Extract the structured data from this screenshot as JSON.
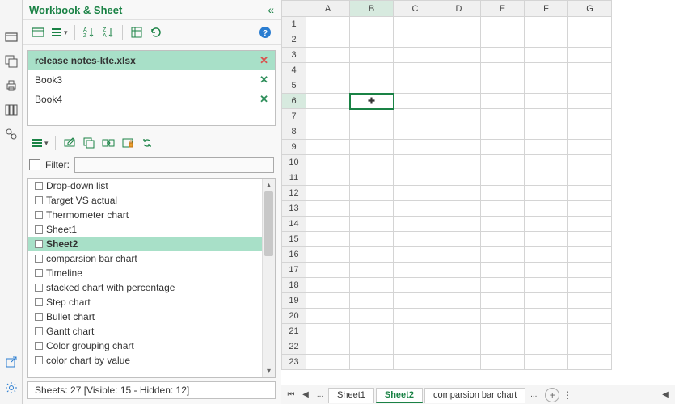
{
  "panel": {
    "title": "Workbook & Sheet",
    "filter_label": "Filter:",
    "filter_value": "",
    "status": "Sheets: 27  [Visible: 15 - Hidden: 12]"
  },
  "workbooks": [
    {
      "name": "release notes-kte.xlsx",
      "active": true
    },
    {
      "name": "Book3",
      "active": false
    },
    {
      "name": "Book4",
      "active": false
    }
  ],
  "sheets": [
    {
      "name": "Drop-down list",
      "selected": false
    },
    {
      "name": "Target VS actual",
      "selected": false
    },
    {
      "name": "Thermometer chart",
      "selected": false
    },
    {
      "name": "Sheet1",
      "selected": false
    },
    {
      "name": "Sheet2",
      "selected": true
    },
    {
      "name": "comparsion bar chart",
      "selected": false
    },
    {
      "name": "Timeline",
      "selected": false
    },
    {
      "name": "stacked chart with percentage",
      "selected": false
    },
    {
      "name": "Step chart",
      "selected": false
    },
    {
      "name": "Bullet chart",
      "selected": false
    },
    {
      "name": "Gantt chart",
      "selected": false
    },
    {
      "name": "Color grouping chart",
      "selected": false
    },
    {
      "name": "color chart by value",
      "selected": false
    }
  ],
  "grid": {
    "columns": [
      "A",
      "B",
      "C",
      "D",
      "E",
      "F",
      "G"
    ],
    "rows": [
      "1",
      "2",
      "3",
      "4",
      "5",
      "6",
      "7",
      "8",
      "9",
      "10",
      "11",
      "12",
      "13",
      "14",
      "15",
      "16",
      "17",
      "18",
      "19",
      "20",
      "21",
      "22",
      "23"
    ],
    "active_col_index": 1,
    "active_row_index": 5
  },
  "tabs": {
    "items": [
      "Sheet1",
      "Sheet2",
      "comparsion bar chart"
    ],
    "active_index": 1,
    "overflow": "...",
    "ellipsis_left": "..."
  }
}
